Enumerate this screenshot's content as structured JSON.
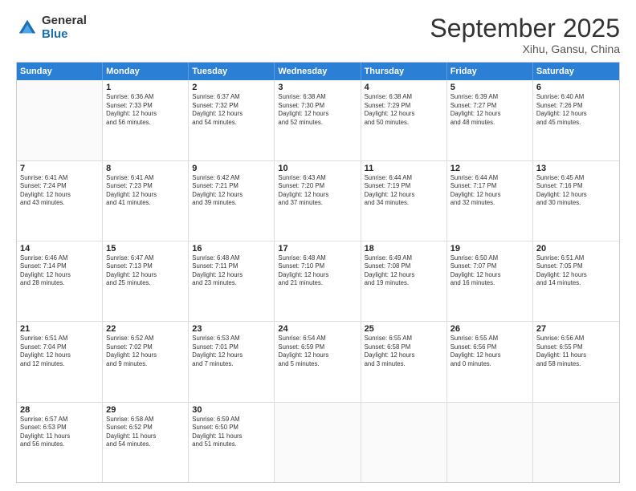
{
  "logo": {
    "general": "General",
    "blue": "Blue"
  },
  "header": {
    "month_title": "September 2025",
    "location": "Xihu, Gansu, China"
  },
  "days_of_week": [
    "Sunday",
    "Monday",
    "Tuesday",
    "Wednesday",
    "Thursday",
    "Friday",
    "Saturday"
  ],
  "weeks": [
    [
      {
        "day": "",
        "info": ""
      },
      {
        "day": "1",
        "info": "Sunrise: 6:36 AM\nSunset: 7:33 PM\nDaylight: 12 hours\nand 56 minutes."
      },
      {
        "day": "2",
        "info": "Sunrise: 6:37 AM\nSunset: 7:32 PM\nDaylight: 12 hours\nand 54 minutes."
      },
      {
        "day": "3",
        "info": "Sunrise: 6:38 AM\nSunset: 7:30 PM\nDaylight: 12 hours\nand 52 minutes."
      },
      {
        "day": "4",
        "info": "Sunrise: 6:38 AM\nSunset: 7:29 PM\nDaylight: 12 hours\nand 50 minutes."
      },
      {
        "day": "5",
        "info": "Sunrise: 6:39 AM\nSunset: 7:27 PM\nDaylight: 12 hours\nand 48 minutes."
      },
      {
        "day": "6",
        "info": "Sunrise: 6:40 AM\nSunset: 7:26 PM\nDaylight: 12 hours\nand 45 minutes."
      }
    ],
    [
      {
        "day": "7",
        "info": "Sunrise: 6:41 AM\nSunset: 7:24 PM\nDaylight: 12 hours\nand 43 minutes."
      },
      {
        "day": "8",
        "info": "Sunrise: 6:41 AM\nSunset: 7:23 PM\nDaylight: 12 hours\nand 41 minutes."
      },
      {
        "day": "9",
        "info": "Sunrise: 6:42 AM\nSunset: 7:21 PM\nDaylight: 12 hours\nand 39 minutes."
      },
      {
        "day": "10",
        "info": "Sunrise: 6:43 AM\nSunset: 7:20 PM\nDaylight: 12 hours\nand 37 minutes."
      },
      {
        "day": "11",
        "info": "Sunrise: 6:44 AM\nSunset: 7:19 PM\nDaylight: 12 hours\nand 34 minutes."
      },
      {
        "day": "12",
        "info": "Sunrise: 6:44 AM\nSunset: 7:17 PM\nDaylight: 12 hours\nand 32 minutes."
      },
      {
        "day": "13",
        "info": "Sunrise: 6:45 AM\nSunset: 7:16 PM\nDaylight: 12 hours\nand 30 minutes."
      }
    ],
    [
      {
        "day": "14",
        "info": "Sunrise: 6:46 AM\nSunset: 7:14 PM\nDaylight: 12 hours\nand 28 minutes."
      },
      {
        "day": "15",
        "info": "Sunrise: 6:47 AM\nSunset: 7:13 PM\nDaylight: 12 hours\nand 25 minutes."
      },
      {
        "day": "16",
        "info": "Sunrise: 6:48 AM\nSunset: 7:11 PM\nDaylight: 12 hours\nand 23 minutes."
      },
      {
        "day": "17",
        "info": "Sunrise: 6:48 AM\nSunset: 7:10 PM\nDaylight: 12 hours\nand 21 minutes."
      },
      {
        "day": "18",
        "info": "Sunrise: 6:49 AM\nSunset: 7:08 PM\nDaylight: 12 hours\nand 19 minutes."
      },
      {
        "day": "19",
        "info": "Sunrise: 6:50 AM\nSunset: 7:07 PM\nDaylight: 12 hours\nand 16 minutes."
      },
      {
        "day": "20",
        "info": "Sunrise: 6:51 AM\nSunset: 7:05 PM\nDaylight: 12 hours\nand 14 minutes."
      }
    ],
    [
      {
        "day": "21",
        "info": "Sunrise: 6:51 AM\nSunset: 7:04 PM\nDaylight: 12 hours\nand 12 minutes."
      },
      {
        "day": "22",
        "info": "Sunrise: 6:52 AM\nSunset: 7:02 PM\nDaylight: 12 hours\nand 9 minutes."
      },
      {
        "day": "23",
        "info": "Sunrise: 6:53 AM\nSunset: 7:01 PM\nDaylight: 12 hours\nand 7 minutes."
      },
      {
        "day": "24",
        "info": "Sunrise: 6:54 AM\nSunset: 6:59 PM\nDaylight: 12 hours\nand 5 minutes."
      },
      {
        "day": "25",
        "info": "Sunrise: 6:55 AM\nSunset: 6:58 PM\nDaylight: 12 hours\nand 3 minutes."
      },
      {
        "day": "26",
        "info": "Sunrise: 6:55 AM\nSunset: 6:56 PM\nDaylight: 12 hours\nand 0 minutes."
      },
      {
        "day": "27",
        "info": "Sunrise: 6:56 AM\nSunset: 6:55 PM\nDaylight: 11 hours\nand 58 minutes."
      }
    ],
    [
      {
        "day": "28",
        "info": "Sunrise: 6:57 AM\nSunset: 6:53 PM\nDaylight: 11 hours\nand 56 minutes."
      },
      {
        "day": "29",
        "info": "Sunrise: 6:58 AM\nSunset: 6:52 PM\nDaylight: 11 hours\nand 54 minutes."
      },
      {
        "day": "30",
        "info": "Sunrise: 6:59 AM\nSunset: 6:50 PM\nDaylight: 11 hours\nand 51 minutes."
      },
      {
        "day": "",
        "info": ""
      },
      {
        "day": "",
        "info": ""
      },
      {
        "day": "",
        "info": ""
      },
      {
        "day": "",
        "info": ""
      }
    ]
  ]
}
